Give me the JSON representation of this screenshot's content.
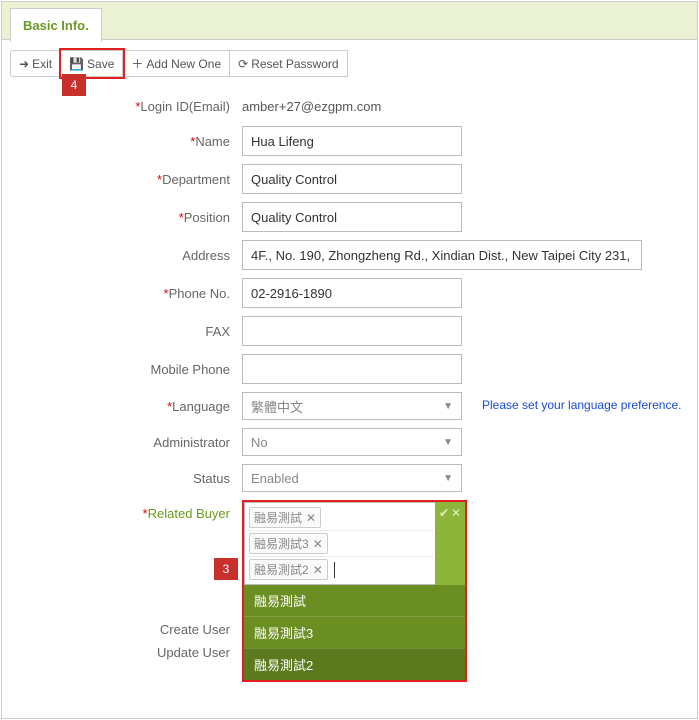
{
  "tab": {
    "label": "Basic Info."
  },
  "toolbar": {
    "exit": "Exit",
    "save": "Save",
    "add": "Add New One",
    "reset": "Reset Password"
  },
  "callouts": {
    "save": "4",
    "related_buyer": "3"
  },
  "labels": {
    "login_id": "Login ID(Email)",
    "name": "Name",
    "department": "Department",
    "position": "Position",
    "address": "Address",
    "phone": "Phone No.",
    "fax": "FAX",
    "mobile": "Mobile Phone",
    "language": "Language",
    "admin": "Administrator",
    "status": "Status",
    "related_buyer": "Related Buyer",
    "create_user": "Create User",
    "update_user": "Update User"
  },
  "values": {
    "login_id": "amber+27@ezgpm.com",
    "name": "Hua Lifeng",
    "department": "Quality Control",
    "position": "Quality Control",
    "address": "4F., No. 190, Zhongzheng Rd., Xindian Dist., New Taipei City 231,",
    "phone": "02-2916-1890",
    "fax": "",
    "mobile": "",
    "language": "繁體中文",
    "admin": "No",
    "status": "Enabled"
  },
  "hint": {
    "language": "Please set your language preference."
  },
  "related_buyer": {
    "tags": [
      "融易測試",
      "融易測試3",
      "融易測試2"
    ],
    "options": [
      "融易測試",
      "融易測試3",
      "融易測試2"
    ],
    "selected_option_index": 2
  }
}
